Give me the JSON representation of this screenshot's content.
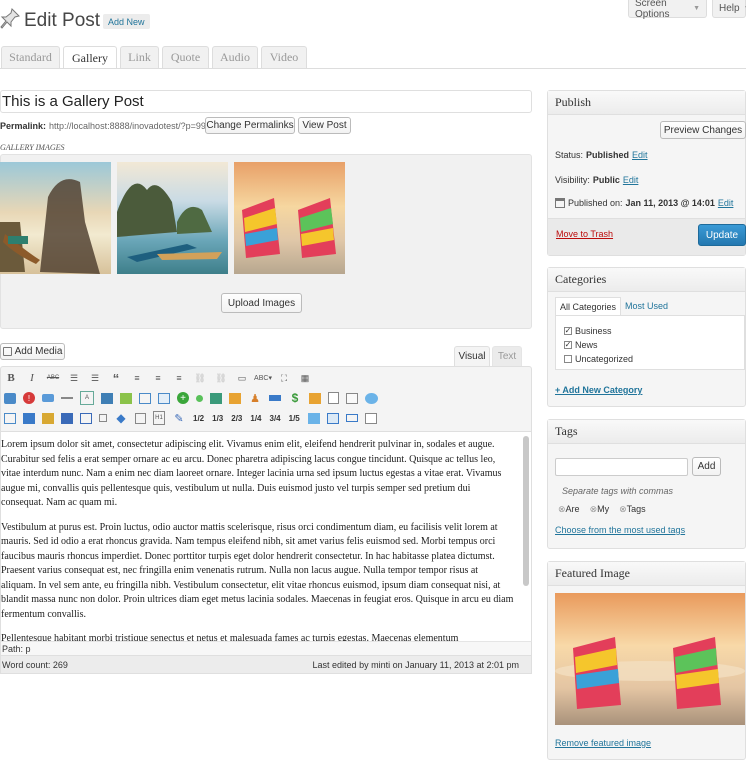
{
  "header": {
    "title": "Edit Post",
    "add_new": "Add New"
  },
  "top_buttons": {
    "screen_options": "Screen Options",
    "help": "Help"
  },
  "format_tabs": [
    {
      "label": "Standard"
    },
    {
      "label": "Gallery"
    },
    {
      "label": "Link"
    },
    {
      "label": "Quote"
    },
    {
      "label": "Audio"
    },
    {
      "label": "Video"
    }
  ],
  "post": {
    "title": "This is a Gallery Post",
    "permalink_label": "Permalink:",
    "permalink_url": "http://localhost:8888/inovadotest/?p=99",
    "change_permalinks": "Change Permalinks",
    "view_post": "View Post"
  },
  "gallery": {
    "label": "GALLERY IMAGES",
    "upload_button": "Upload Images"
  },
  "editor": {
    "add_media": "Add Media",
    "tab_visual": "Visual",
    "tab_text": "Text",
    "toolbar_row1": [
      "B",
      "I",
      "ABC",
      "≡",
      "≡",
      "“",
      "≡",
      "≡",
      "≡"
    ],
    "fractions": [
      "1/2",
      "1/3",
      "2/3",
      "1/4",
      "3/4",
      "1/5"
    ],
    "paragraphs": [
      "Lorem ipsum dolor sit amet, consectetur adipiscing elit. Vivamus enim elit, eleifend hendrerit pulvinar in, sodales et augue. Curabitur sed felis a erat semper ornare ac eu arcu. Donec pharetra adipiscing lacus congue tincidunt. Quisque ac tellus leo, vitae interdum nunc. Nam a enim nec diam laoreet ornare. Integer lacinia urna sed ipsum luctus egestas a vitae erat. Vivamus augue mi, convallis quis pellentesque quis, vestibulum ut nulla. Duis euismod justo vel turpis semper sed pretium dui consequat. Nam ac quam mi.",
      "Vestibulum at purus est. Proin luctus, odio auctor mattis scelerisque, risus orci condimentum diam, eu facilisis velit lorem at mauris. Sed id odio a erat rhoncus gravida. Nam tempus eleifend nibh, sit amet varius felis euismod sed. Morbi tempus orci faucibus mauris rhoncus imperdiet. Donec porttitor turpis eget dolor hendrerit consectetur. In hac habitasse platea dictumst. Praesent varius consequat est, nec fringilla enim venenatis rutrum. Nulla non lacus augue. Nulla tempor tempor risus at aliquam. In vel sem ante, eu fringilla nibh. Vestibulum consectetur, elit vitae rhoncus euismod, ipsum diam consequat nisi, at blandit massa nunc non dolor. Proin ultrices diam eget metus lacinia sodales. Maecenas in feugiat eros. Quisque in arcu eu diam fermentum convallis.",
      "Pellentesque habitant morbi tristique senectus et netus et malesuada fames ac turpis egestas. Maecenas elementum"
    ],
    "path": "Path: p",
    "word_count": "Word count: 269",
    "last_edited": "Last edited by minti on January 11, 2013 at 2:01 pm"
  },
  "publish": {
    "title": "Publish",
    "preview": "Preview Changes",
    "status_label": "Status:",
    "status_value": "Published",
    "edit": "Edit",
    "visibility_label": "Visibility:",
    "visibility_value": "Public",
    "published_on_label": "Published on:",
    "published_on_value": "Jan 11, 2013 @ 14:01",
    "move_to_trash": "Move to Trash",
    "update": "Update"
  },
  "categories": {
    "title": "Categories",
    "tab_all": "All Categories",
    "tab_most": "Most Used",
    "items": [
      {
        "label": "Business",
        "checked": true
      },
      {
        "label": "News",
        "checked": true
      },
      {
        "label": "Uncategorized",
        "checked": false
      }
    ],
    "add_new": "+ Add New Category"
  },
  "tags": {
    "title": "Tags",
    "add": "Add",
    "hint": "Separate tags with commas",
    "existing": [
      "Are",
      "My",
      "Tags"
    ],
    "choose": "Choose from the most used tags"
  },
  "featured": {
    "title": "Featured Image",
    "remove": "Remove featured image"
  },
  "colors": {
    "link": "#21759b",
    "update_button": "#2e8cc4",
    "trash": "#bc0b0b"
  }
}
